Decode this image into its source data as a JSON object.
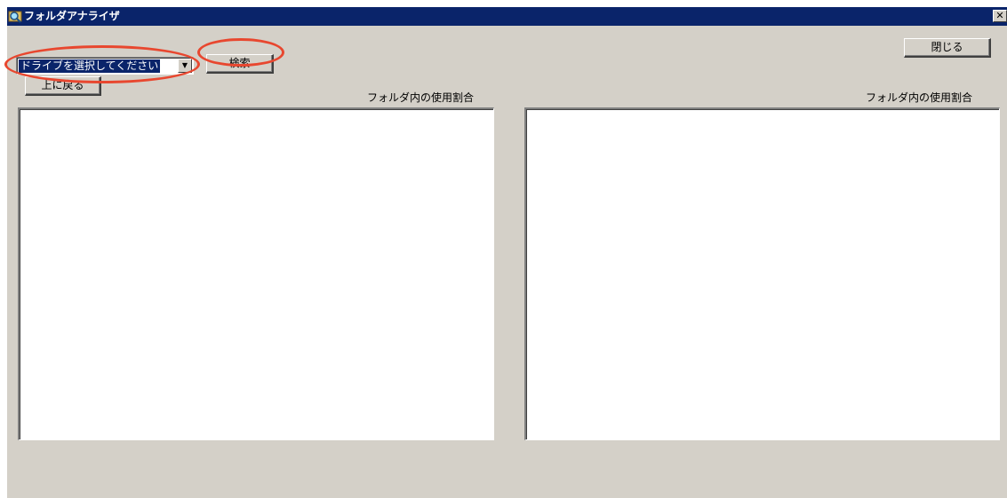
{
  "window": {
    "title": "フォルダアナライザ",
    "close_glyph": "✕"
  },
  "toolbar": {
    "drive_select_value": "ドライブを選択してください",
    "search_label": "検索",
    "up_label": "上に戻る",
    "close_label": "閉じる"
  },
  "panels": {
    "left_caption": "フォルダ内の使用割合",
    "right_caption": "フォルダ内の使用割合"
  },
  "colors": {
    "titlebar": "#0a246a",
    "window_bg": "#d4d0c8",
    "annotation": "#e8472f"
  },
  "icons": {
    "app": "magnifier-folder-icon",
    "dropdown": "chevron-down-icon",
    "close": "close-icon"
  }
}
